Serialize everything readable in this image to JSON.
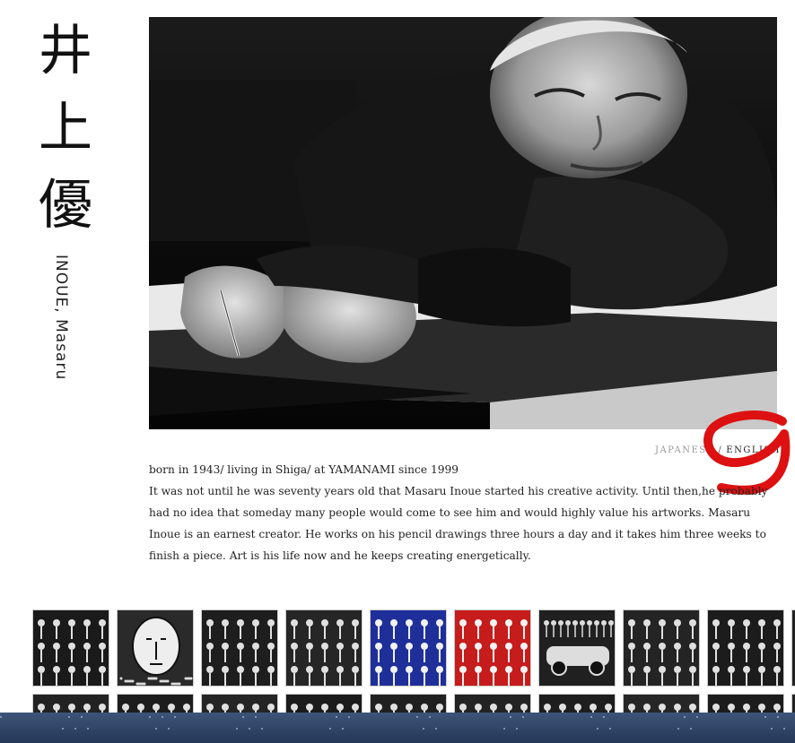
{
  "artist": {
    "name_kanji": [
      "井",
      "上",
      "優"
    ],
    "name_roman": "INOUE, Masaru"
  },
  "language": {
    "japanese": "JAPANESE",
    "separator": "/",
    "english": "ENGLISH"
  },
  "bio": {
    "line1": "born in 1943/ living in Shiga/ at YAMANAMI since 1999",
    "body": "It was not until he was seventy years old that Masaru Inoue started his creative activity. Until then,he probably had no idea that someday many people would come to see him and would highly value his artworks. Masaru Inoue is an earnest creator. He works on his pencil drawings three hours a day and it takes him three weeks to finish a piece. Art is his life now and he keeps creating energetically."
  },
  "gallery": {
    "row1": [
      {
        "theme": "dark",
        "bg": "#1a1a1a"
      },
      {
        "theme": "face",
        "bg": "#2a2a2a"
      },
      {
        "theme": "dark",
        "bg": "#1e1e1e"
      },
      {
        "theme": "dark",
        "bg": "#262626"
      },
      {
        "theme": "blue",
        "bg": "#1f2f9a"
      },
      {
        "theme": "red",
        "bg": "#c61c1c"
      },
      {
        "theme": "car",
        "bg": "#202020"
      },
      {
        "theme": "dark",
        "bg": "#242424"
      },
      {
        "theme": "dark",
        "bg": "#1c1c1c"
      },
      {
        "theme": "dark",
        "bg": "#222222"
      }
    ],
    "row2": [
      {
        "bg": "#222222"
      },
      {
        "bg": "#1d1d1d"
      },
      {
        "bg": "#252525"
      },
      {
        "bg": "#1b1b1b"
      },
      {
        "bg": "#202020"
      },
      {
        "bg": "#232323"
      },
      {
        "bg": "#1e1e1e"
      },
      {
        "bg": "#262626"
      },
      {
        "bg": "#1c1c1c"
      },
      {
        "bg": "#222222"
      }
    ]
  },
  "colors": {
    "annotation_red": "#dd1111",
    "footer_top": "#3e5478",
    "footer_bottom": "#243757"
  }
}
